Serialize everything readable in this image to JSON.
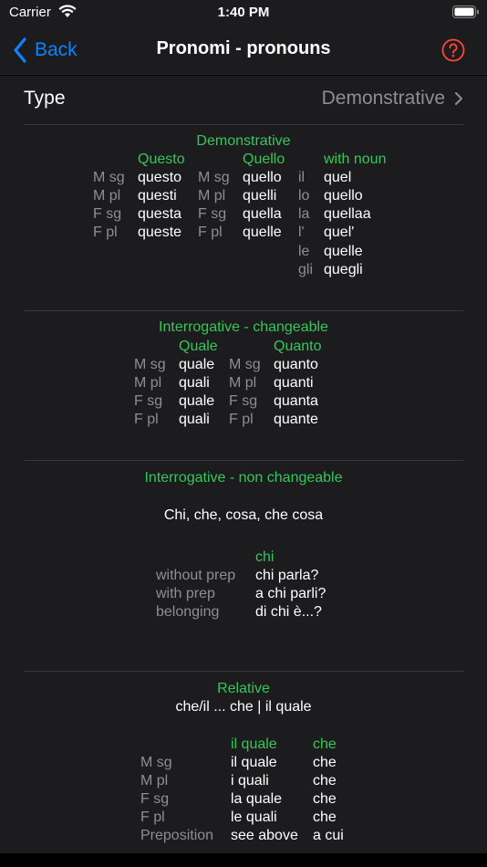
{
  "status": {
    "carrier": "Carrier",
    "time": "1:40 PM"
  },
  "nav": {
    "back_label": "Back",
    "title": "Pronomi - pronouns"
  },
  "type_row": {
    "label": "Type",
    "value": "Demonstrative"
  },
  "demonstrative": {
    "title": "Demonstrative",
    "headers": [
      "Questo",
      "Quello",
      "with noun"
    ],
    "genders": [
      "M sg",
      "M pl",
      "F sg",
      "F pl"
    ],
    "questo": [
      "questo",
      "questi",
      "questa",
      "queste"
    ],
    "quello": [
      "quello",
      "quelli",
      "quella",
      "quelle"
    ],
    "articles": [
      "il",
      "lo",
      "la",
      "l'",
      "le",
      "gli"
    ],
    "with_noun": [
      "quel",
      "quello",
      "quellaa",
      "quel'",
      "quelle",
      "quegli"
    ]
  },
  "interrogative_changeable": {
    "title": "Interrogative - changeable",
    "headers": [
      "Quale",
      "Quanto"
    ],
    "genders": [
      "M sg",
      "M pl",
      "F sg",
      "F pl"
    ],
    "quale": [
      "quale",
      "quali",
      "quale",
      "quali"
    ],
    "quanto": [
      "quanto",
      "quanti",
      "quanta",
      "quante"
    ]
  },
  "interrogative_non_changeable": {
    "title": "Interrogative - non changeable",
    "forms": "Chi, che, cosa, che cosa",
    "chi_header": "chi",
    "labels": [
      "without prep",
      "with prep",
      "belonging"
    ],
    "examples": [
      "chi parla?",
      "a chi parli?",
      "di chi è...?"
    ]
  },
  "relative": {
    "title": "Relative",
    "forms": "che/il ... che | il quale",
    "headers": [
      "il quale",
      "che"
    ],
    "labels": [
      "M sg",
      "M pl",
      "F sg",
      "F pl",
      "Preposition"
    ],
    "il_quale": [
      "il quale",
      "i quali",
      "la quale",
      "le quali",
      "see above"
    ],
    "che": [
      "che",
      "che",
      "che",
      "che",
      "a cui"
    ]
  },
  "colors": {
    "accent": "#0a84ff",
    "green": "#34c759",
    "help": "#ff453a",
    "secondary": "#8e8e93"
  }
}
